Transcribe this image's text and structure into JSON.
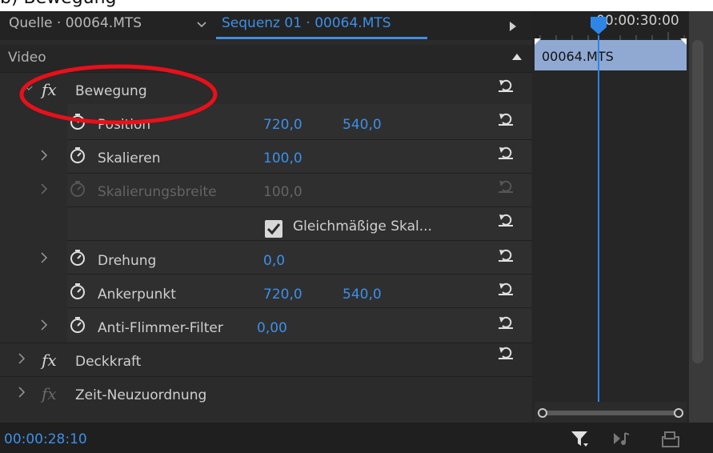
{
  "header": {
    "top_clipped_text": "b) Bewegung",
    "tab_source": "Quelle · 00064.MTS",
    "tab_sequence": "Sequenz 01 · 00064.MTS",
    "timecode_ruler": "00:00:30:00"
  },
  "panel": {
    "section_label": "Video",
    "effects": [
      {
        "name": "Bewegung",
        "fx_glyph": "fx"
      },
      {
        "name": "Deckkraft",
        "fx_glyph": "fx"
      },
      {
        "name": "Zeit-Neuzuordnung",
        "fx_glyph": "fx"
      }
    ],
    "properties": {
      "position": {
        "label": "Position",
        "x": "720,0",
        "y": "540,0"
      },
      "scale": {
        "label": "Skalieren",
        "value": "100,0"
      },
      "scale_width": {
        "label": "Skalierungsbreite",
        "value": "100,0"
      },
      "uniform_scale": {
        "label": "Gleichmäßige Skal..."
      },
      "rotation": {
        "label": "Drehung",
        "value": "0,0"
      },
      "anchor": {
        "label": "Ankerpunkt",
        "x": "720,0",
        "y": "540,0"
      },
      "anti_flicker": {
        "label": "Anti-Flimmer-Filter",
        "value": "0,00"
      }
    }
  },
  "timeline": {
    "clip_name": "00064.MTS"
  },
  "footer": {
    "current_time": "00:00:28:10"
  },
  "colors": {
    "accent": "#3d8fe8",
    "annotation": "#e8101a",
    "clip": "#8fa9d2"
  }
}
